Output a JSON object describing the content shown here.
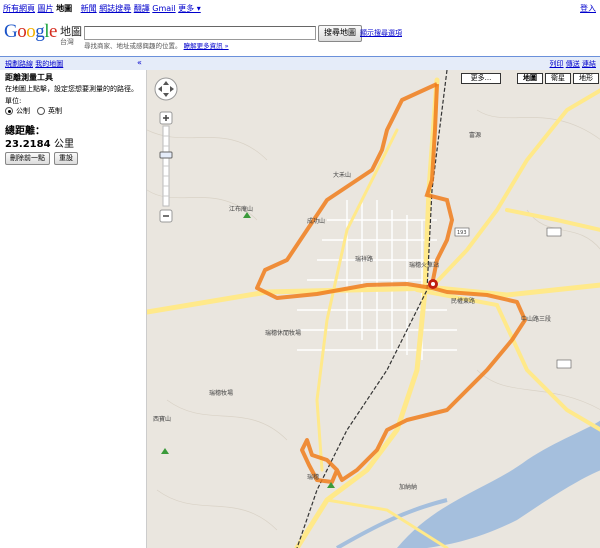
{
  "topnav": {
    "links": [
      "所有網頁",
      "圖片",
      "地圖",
      "新聞",
      "網誌搜尋",
      "翻譯",
      "Gmail",
      "更多 ▾"
    ],
    "active_index": 2,
    "signin": "登入"
  },
  "logo": {
    "text_g": "G",
    "text_o1": "o",
    "text_o2": "o",
    "text_g2": "g",
    "text_l": "l",
    "text_e": "e",
    "product": "地圖",
    "region": "台灣"
  },
  "search": {
    "value": "",
    "button": "搜尋地圖",
    "options_link": "顯示搜尋選項",
    "hint": "尋找商家、地址或感興趣的位置。",
    "hint_link": "瞭解更多資訊 »"
  },
  "pathbar": {
    "left_links": [
      "規劃路線",
      "我的地圖"
    ],
    "collapse": "«",
    "right_links": [
      "列印",
      "傳送",
      "連結"
    ]
  },
  "panel": {
    "title": "距離測量工具",
    "instruction": "在地圖上點擊，設定您想要測量的的路徑。",
    "units_label": "單位:",
    "unit_metric": "公制",
    "unit_imperial": "英制",
    "total_label": "總距離：",
    "total_value": "23.2184",
    "total_unit": "公里",
    "delete_button": "刪除前一點",
    "reset_button": "重設"
  },
  "map": {
    "more_button": "更多...",
    "map_types": [
      "地圖",
      "衛星",
      "地形"
    ],
    "active_type": "地圖",
    "labels": [
      "江布庵山",
      "瑞穗火車站",
      "中山路三段",
      "民權東路",
      "成功山",
      "瑞祥路",
      "瑞穗休閒牧場",
      "瑞穗牧場",
      "西寶山",
      "加納納",
      "大禾山",
      "富源",
      "瑞穗",
      "193"
    ],
    "route_color": "#f07c1c",
    "road_color": "#ffe98a"
  }
}
